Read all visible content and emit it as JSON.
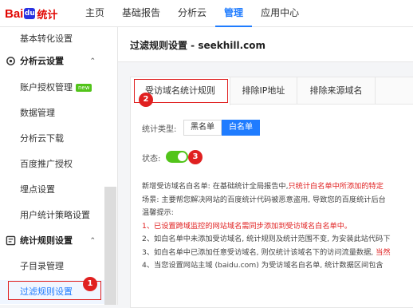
{
  "brand": {
    "bai": "Bai",
    "paw": "du",
    "du": "",
    "tongji": "统计"
  },
  "nav": {
    "items": [
      {
        "label": "主页"
      },
      {
        "label": "基础报告"
      },
      {
        "label": "分析云"
      },
      {
        "label": "管理",
        "active": true
      },
      {
        "label": "应用中心"
      }
    ]
  },
  "sidebar": {
    "item_basic_conversion": "基本转化设置",
    "group_analytics": "分析云设置",
    "item_account_auth": "账户授权管理",
    "new_badge": "new",
    "item_data_mgmt": "数据管理",
    "item_cloud_download": "分析云下载",
    "item_baidu_auth": "百度推广授权",
    "item_tracking": "埋点设置",
    "item_user_strategy": "用户统计策略设置",
    "group_rules": "统计规则设置",
    "item_subdir": "子目录管理",
    "item_filter_rules": "过滤规则设置"
  },
  "page": {
    "title": "过滤规则设置 - seekhill.com"
  },
  "tabs": [
    "受访域名统计规则",
    "排除IP地址",
    "排除来源域名"
  ],
  "form": {
    "type_label": "统计类型:",
    "blacklist": "黑名单",
    "whitelist": "白名单",
    "status_label": "状态:",
    "status_on": true
  },
  "description": {
    "line1_a": "新增受访域名白名单: 在基础统计全局报告中,",
    "line1_b": "只统计白名单中所添加的特定",
    "line2": "场景: 主要帮您解决网站的百度统计代码被恶意盗用, 导致您的百度统计后台",
    "line3": "温馨提示:",
    "line4_a": "1、",
    "line4_b": "已设置跨域监控的网站域名需同步添加到受访域名白名单中。",
    "line5": "2、如白名单中未添加受访域名, 统计规则及统计范围不变, 为安装此站代码下",
    "line6_a": "3、如白名单中已添加任意受访域名, 则仅统计该域名下的访问流量数据,",
    "line6_b": " 当然",
    "line7": "4、当您设置网站主域 (baidu.com) 为受访域名白名单, 统计数据区间包含"
  },
  "annotations": [
    "1",
    "2",
    "3"
  ],
  "colors": {
    "accent": "#1f7cff",
    "highlight": "#e02020",
    "toggle_on": "#52c41a"
  }
}
